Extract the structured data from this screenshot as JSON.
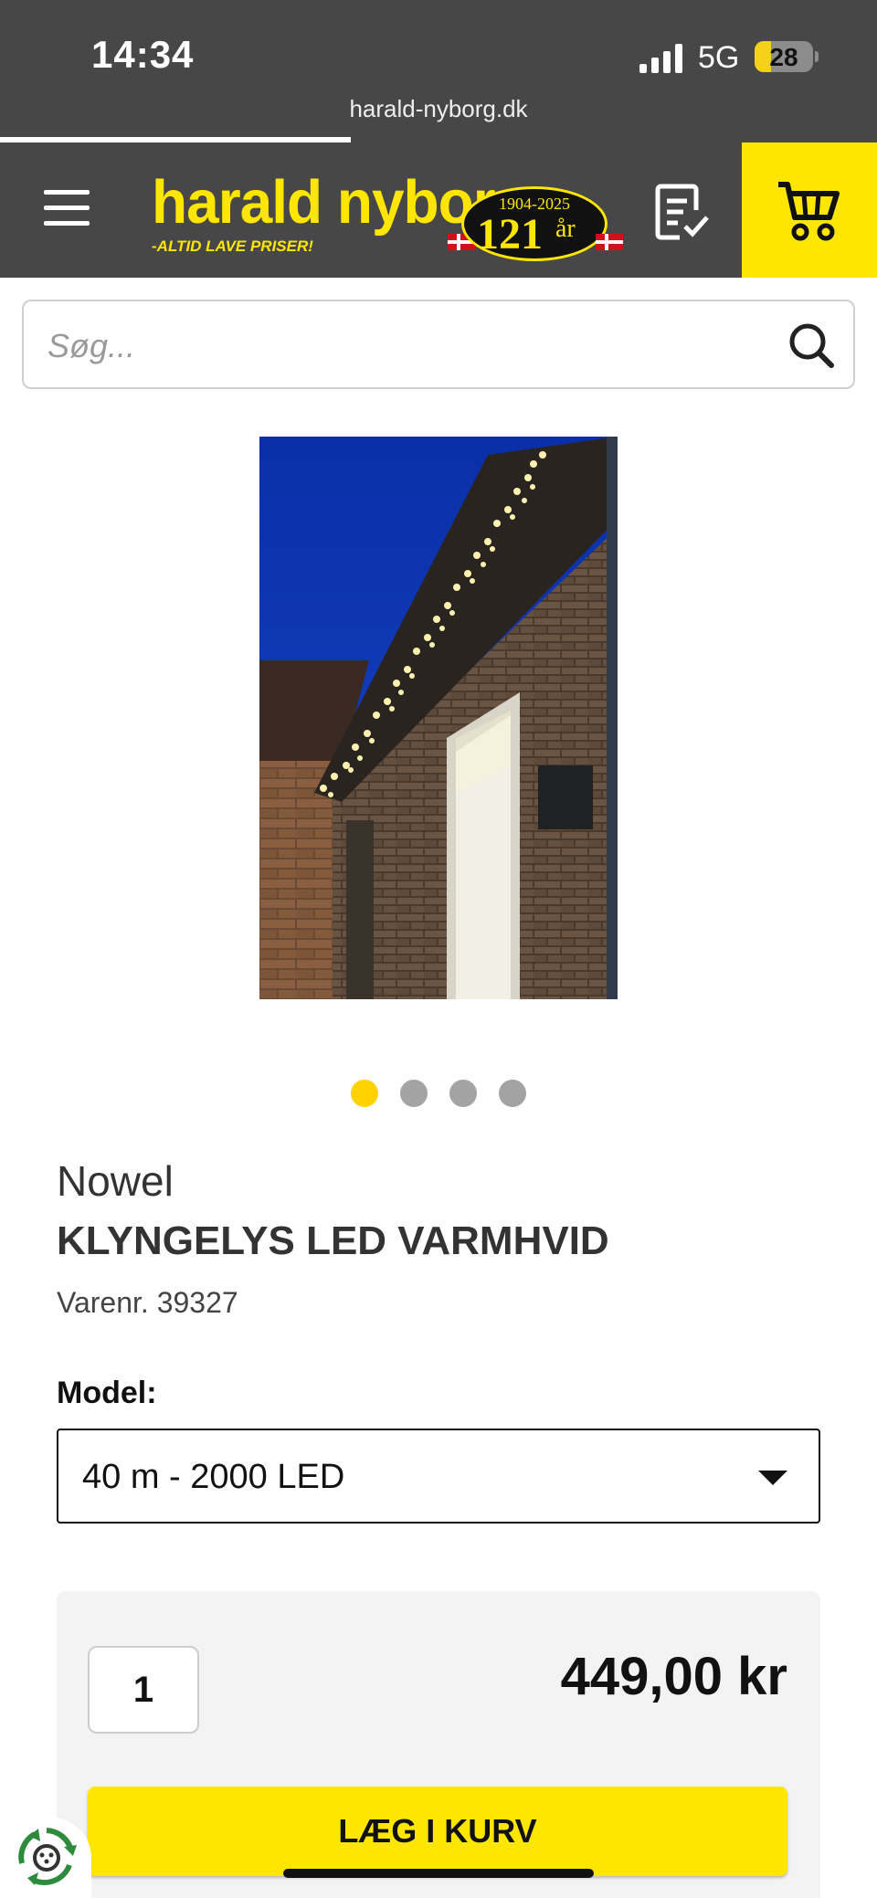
{
  "status_bar": {
    "time": "14:34",
    "network": "5G",
    "battery": "28",
    "battery_fraction": 0.28,
    "url": "harald-nyborg.dk",
    "page_load_fraction": 0.4
  },
  "header": {
    "logo": {
      "name": "harald nyborg",
      "slogan": "-ALTID LAVE PRISER!",
      "anniversary_years": "1904-2025",
      "anniversary_number": "121",
      "anniversary_unit": "år"
    },
    "icons": {
      "menu": "hamburger-menu-icon",
      "list": "shopping-list-icon",
      "cart": "cart-icon"
    },
    "colors": {
      "header_bg": "#474747",
      "brand_yellow": "#ffe600"
    }
  },
  "search": {
    "placeholder": "Søg..."
  },
  "gallery": {
    "image_count": 4,
    "active_index": 0
  },
  "product": {
    "brand": "Nowel",
    "title": "KLYNGELYS LED VARMHVID",
    "sku_label": "Varenr.",
    "sku": "39327",
    "model_label": "Model:",
    "model_selected": "40 m - 2000 LED",
    "quantity": "1",
    "price": "449,00 kr",
    "add_to_cart": "LÆG I KURV"
  }
}
